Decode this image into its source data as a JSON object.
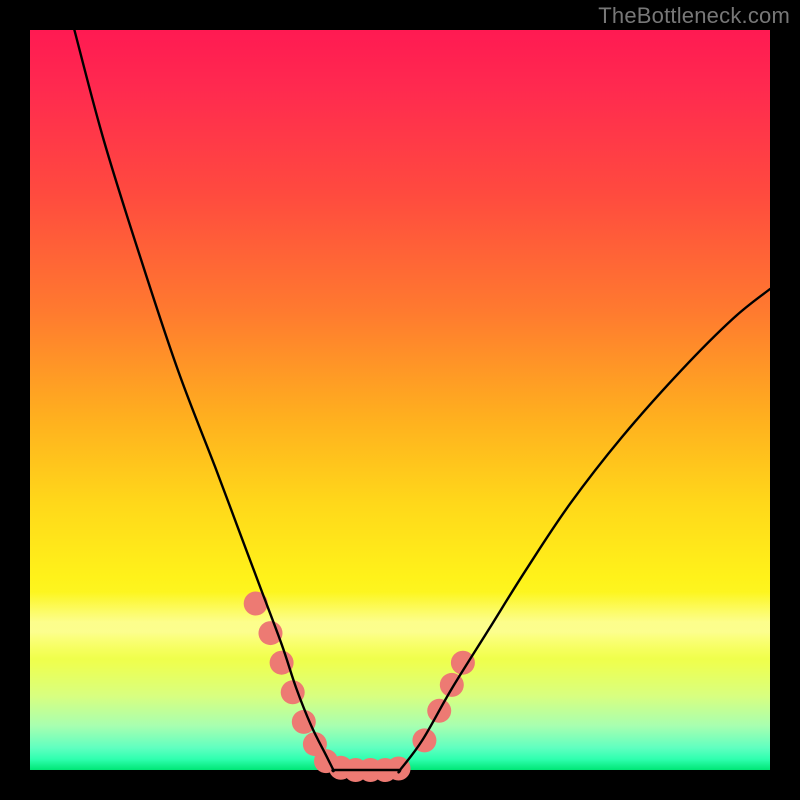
{
  "watermark": "TheBottleneck.com",
  "chart_data": {
    "type": "line",
    "title": "",
    "xlabel": "",
    "ylabel": "",
    "xlim": [
      0,
      100
    ],
    "ylim": [
      0,
      100
    ],
    "grid": false,
    "legend": false,
    "note": "Values are approximate, read from the unlabeled figure; x = horizontal % of plot width, y = vertical % of plot height (0 at bottom, 100 at top).",
    "series": [
      {
        "name": "left-branch",
        "x": [
          6,
          10,
          15,
          20,
          25,
          28,
          31,
          34,
          36,
          38,
          40,
          41
        ],
        "y": [
          100,
          85,
          69,
          54,
          41,
          33,
          25,
          17,
          11,
          6,
          2,
          0
        ],
        "stroke": "#000000"
      },
      {
        "name": "valley-floor",
        "x": [
          41,
          43,
          45,
          47,
          49,
          50
        ],
        "y": [
          0,
          0,
          0,
          0,
          0,
          0
        ],
        "stroke": "#000000"
      },
      {
        "name": "right-branch",
        "x": [
          50,
          53,
          57,
          62,
          67,
          73,
          80,
          88,
          95,
          100
        ],
        "y": [
          0,
          4,
          11,
          19,
          27,
          36,
          45,
          54,
          61,
          65
        ],
        "stroke": "#000000"
      }
    ],
    "markers": {
      "name": "salmon-dots",
      "color": "#ed7a73",
      "radius_px": 12,
      "points_xy_pct": [
        [
          30.5,
          22.5
        ],
        [
          32.5,
          18.5
        ],
        [
          34.0,
          14.5
        ],
        [
          35.5,
          10.5
        ],
        [
          37.0,
          6.5
        ],
        [
          38.5,
          3.5
        ],
        [
          40.0,
          1.2
        ],
        [
          42.0,
          0.3
        ],
        [
          44.0,
          0.0
        ],
        [
          46.0,
          0.0
        ],
        [
          48.0,
          0.0
        ],
        [
          49.8,
          0.2
        ],
        [
          53.3,
          4.0
        ],
        [
          55.3,
          8.0
        ],
        [
          57.0,
          11.5
        ],
        [
          58.5,
          14.5
        ]
      ]
    }
  }
}
